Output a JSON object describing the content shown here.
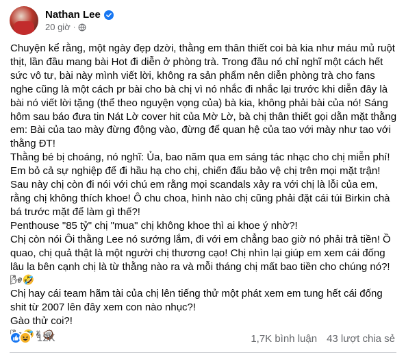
{
  "post": {
    "author": "Nathan Lee",
    "time": "20 giờ",
    "separator": "·",
    "paragraphs": [
      "Chuyện kể rằng, một ngày đẹp dzời, thằng em thân thiết coi bà kia như máu mủ ruột thịt, lần đầu mang bài Hot đi diễn ở phòng trà. Trong đầu nó chỉ nghĩ một cách hết sức vô tư, bài này mình viết lời, không ra sản phẩm nên diễn phòng trà cho fans nghe cũng là một cách pr bài cho bà chị vì nó nhắc đi nhắc lại trước khi diễn đây là bài nó viết lời tặng (thể theo nguyện vọng của) bà kia, không phải bài của nó! Sáng hôm sau báo đưa tin Nát Lờ cover hit của Mờ Lờ, bà chị thân thiết gọi dằn mặt thằng em: Bài của tao mày đừng động vào, đừng để quan hệ của tao với mày như tao với thằng ĐT!",
      "Thằng bé bị choáng, nó nghĩ: Ủa, bao năm qua em sáng tác nhạc cho chị miễn phí! Em bỏ cả sự nghiệp để đi hầu hạ cho chị, chiến đấu bảo vệ chị trên mọi mặt trận! Sau này chị còn đi nói với chú em rằng mọi scandals xảy ra với chị là lỗi của em, rằng chị không thích khoe! Ô chu choa, hình nào chị cũng phải đặt cái túi Birkin chà bá trước mặt để làm gì thế?!",
      "Penthouse \"85 tỷ\" chị \"mua\" chị không khoe thì ai khoe ý nhờ?!",
      "Chị còn nói Ôi thằng Lee nó sướng lắm, đi với em chẳng bao giờ nó phải trả tiền! Ồ quao, chị quả thật là một người chị thương cạo! Chị nhìn lại giúp em xem cái đống lâu la bên cạnh chị là từ thằng nào ra và mỗi tháng chị mất bao tiền cho chúng nó?!",
      "🌬🤣",
      "Chị hay cái team hãm tài của chị lên tiếng thử một phát xem em tung hết cái đống shit từ 2007 lên đây xem con nào nhục?!",
      "Gào thử coi?!",
      "🌬🤣✌🥥"
    ]
  },
  "stats": {
    "reactions_count": "12K",
    "comments": "1,7K bình luận",
    "shares": "43 lượt chia sẻ"
  },
  "icons": {
    "verified": "verified-badge-icon",
    "globe": "globe-icon",
    "like": "like-reaction-icon",
    "haha": "haha-reaction-icon"
  },
  "colors": {
    "brand": "#1877f2",
    "secondary_text": "#65676b",
    "haha": "#f7b125"
  }
}
